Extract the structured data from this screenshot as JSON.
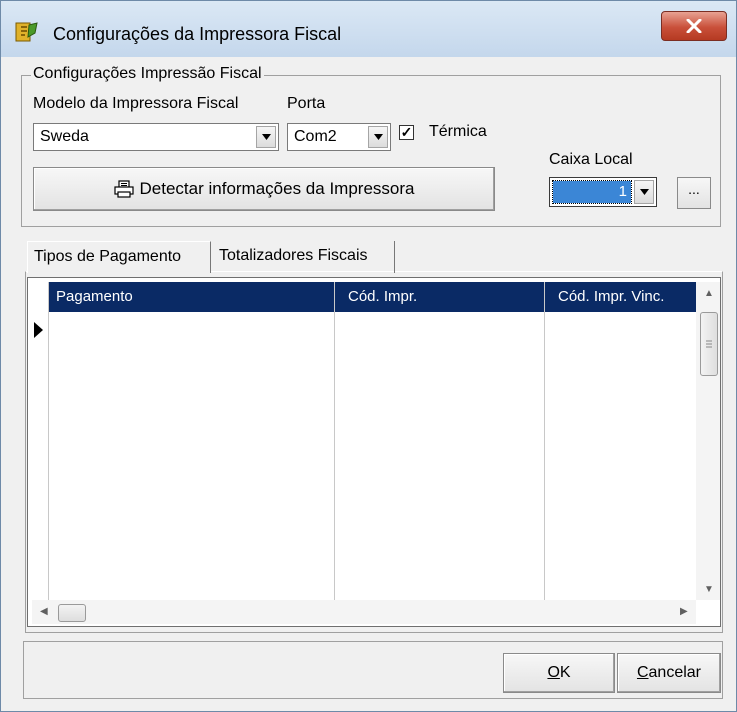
{
  "window": {
    "title": "Configurações da Impressora Fiscal",
    "close_symbol": "X"
  },
  "settings_group": {
    "legend": "Configurações Impressão Fiscal",
    "model_label": "Modelo da Impressora Fiscal",
    "model_value": "Sweda",
    "port_label": "Porta",
    "port_value": "Com2",
    "thermal_checked": true,
    "thermal_label": "Térmica",
    "detect_button": "Detectar informações da Impressora",
    "caixa_label": "Caixa Local",
    "caixa_value": "1",
    "ellipsis_button": "..."
  },
  "tabs": [
    {
      "label": "Tipos de Pagamento",
      "active": true
    },
    {
      "label": "Totalizadores Fiscais",
      "active": false
    }
  ],
  "grid": {
    "columns": [
      "Pagamento",
      "Cód. Impr.",
      "Cód. Impr. Vinc."
    ],
    "rows": []
  },
  "footer": {
    "ok_first": "O",
    "ok_rest": "K",
    "cancel_first": "C",
    "cancel_rest": "ancelar"
  },
  "colors": {
    "grid_header": "#0a2a65",
    "selection": "#3b86d6",
    "close_button": "#c9503a"
  },
  "icons": [
    "app-icon",
    "close-icon",
    "printer-icon",
    "chevron-down-icon",
    "row-pointer-icon",
    "scroll-arrow-icons"
  ]
}
